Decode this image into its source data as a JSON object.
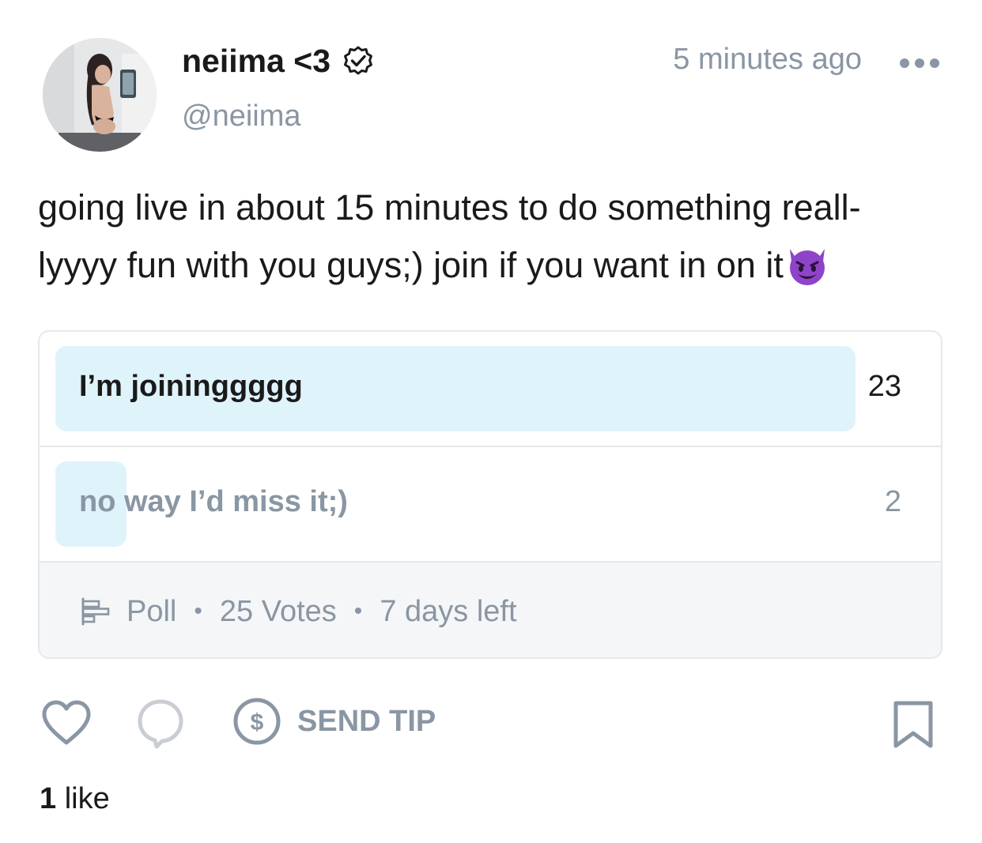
{
  "post": {
    "author": {
      "display_name": "neiima <3",
      "handle": "@neiima",
      "verified": true
    },
    "timestamp": "5 minutes ago",
    "text_lines": [
      "going live in about 15 minutes to do something reall-",
      "lyyyy fun with you guys;) join if you want in on it"
    ],
    "emoji": "smiling-devil-emoji"
  },
  "poll": {
    "options": [
      {
        "label": "I’m joininggggg",
        "votes": "23",
        "fraction": 0.92
      },
      {
        "label": "no way I’d miss it;)",
        "votes": "2",
        "fraction": 0.08
      }
    ],
    "footer": {
      "type_label": "Poll",
      "votes_label": "25 Votes",
      "time_left": "7 days left",
      "separator": "•"
    }
  },
  "actions": {
    "tip_label": "SEND TIP"
  },
  "likes": {
    "count": "1",
    "label": "like"
  },
  "colors": {
    "muted": "#8a96a3",
    "poll_fill": "#dff3fb",
    "emoji_purple": "#8e44c9"
  }
}
